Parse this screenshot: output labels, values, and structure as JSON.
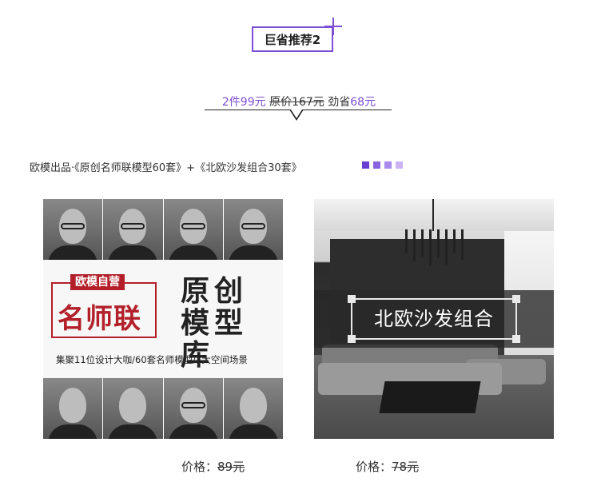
{
  "section": {
    "tag_label": "巨省推荐2"
  },
  "promo": {
    "deal": "2件99元",
    "original_label": "原价",
    "original_price": "167元",
    "save_label": "劲省",
    "save_amount": "68元"
  },
  "description": {
    "text": "欧模出品·《原创名师联模型60套》+《北欧沙发组合30套》"
  },
  "colors": {
    "accent": "#7b4fd6",
    "brand_red": "#b3202a",
    "dots": [
      "#6a3fd0",
      "#8a63e0",
      "#a989ea",
      "#c9b3f3"
    ]
  },
  "products": [
    {
      "image": {
        "label": "欧模自营",
        "brand": "名师联",
        "title": "原创模型库",
        "subtitle": "集聚11位设计大咖/60套名师模型/7大空间场景"
      },
      "price_label": "价格：",
      "price_value": "89元"
    },
    {
      "image": {
        "banner": "北欧沙发组合"
      },
      "price_label": "价格：",
      "price_value": "78元"
    }
  ]
}
